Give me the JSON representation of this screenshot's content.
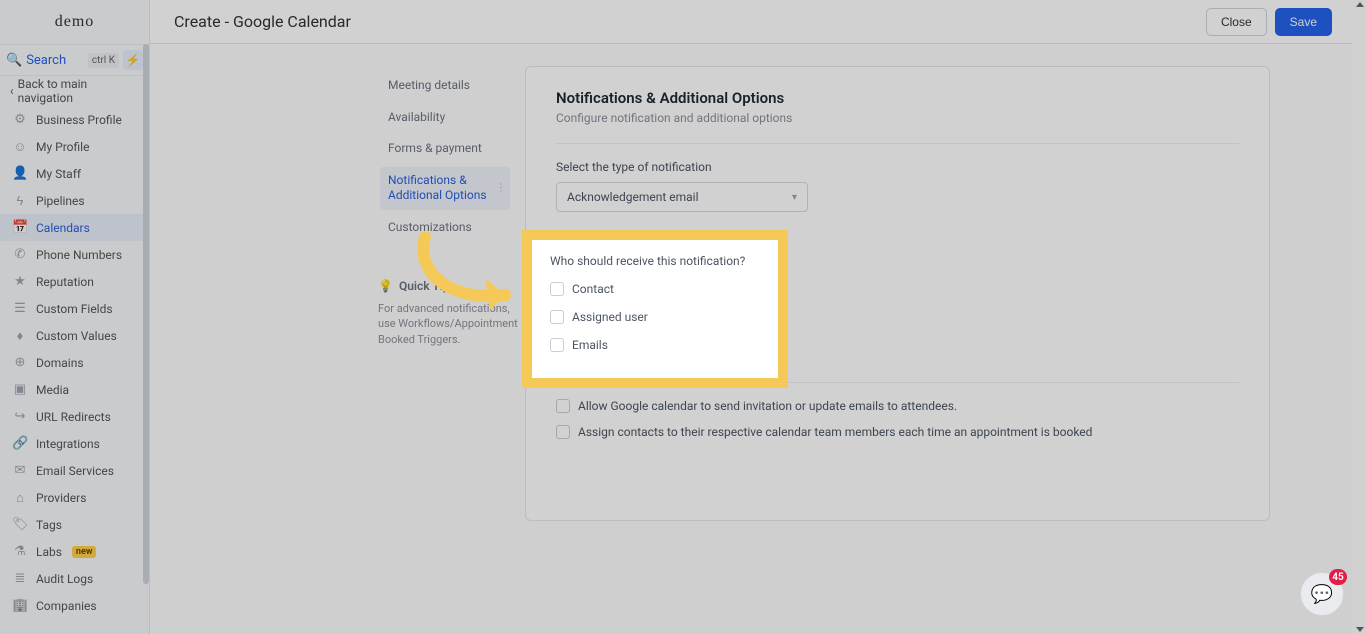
{
  "brand": "demo",
  "search": {
    "label": "Search",
    "shortcut": "ctrl K"
  },
  "back_label": "Back to main navigation",
  "sidebar": {
    "items": [
      {
        "label": "Business Profile",
        "icon": "⚙"
      },
      {
        "label": "My Profile",
        "icon": "☺"
      },
      {
        "label": "My Staff",
        "icon": "👤"
      },
      {
        "label": "Pipelines",
        "icon": "ϟ"
      },
      {
        "label": "Calendars",
        "icon": "📅"
      },
      {
        "label": "Phone Numbers",
        "icon": "✆"
      },
      {
        "label": "Reputation",
        "icon": "★"
      },
      {
        "label": "Custom Fields",
        "icon": "☰"
      },
      {
        "label": "Custom Values",
        "icon": "♦"
      },
      {
        "label": "Domains",
        "icon": "⊕"
      },
      {
        "label": "Media",
        "icon": "▣"
      },
      {
        "label": "URL Redirects",
        "icon": "↪"
      },
      {
        "label": "Integrations",
        "icon": "🔗"
      },
      {
        "label": "Email Services",
        "icon": "✉"
      },
      {
        "label": "Providers",
        "icon": "⌂"
      },
      {
        "label": "Tags",
        "icon": "🏷"
      },
      {
        "label": "Labs",
        "icon": "⚗"
      },
      {
        "label": "Audit Logs",
        "icon": "≣"
      },
      {
        "label": "Companies",
        "icon": "🏢"
      }
    ],
    "active_index": 4,
    "labs_badge": "new"
  },
  "topbar": {
    "title": "Create - Google Calendar",
    "close": "Close",
    "save": "Save"
  },
  "steps": {
    "items": [
      "Meeting details",
      "Availability",
      "Forms & payment",
      "Notifications & Additional Options",
      "Customizations"
    ],
    "active_index": 3
  },
  "quicktip": {
    "title": "Quick Tip",
    "text": "For advanced notifications, use Workflows/Appointment Booked Triggers."
  },
  "card": {
    "title": "Notifications & Additional Options",
    "subtitle": "Configure notification and additional options",
    "select_label": "Select the type of notification",
    "select_value": "Acknowledgement email",
    "who_label": "Who should receive this notification?",
    "options": [
      "Contact",
      "Assigned user",
      "Emails"
    ],
    "extra": [
      "Allow Google calendar to send invitation or update emails to attendees.",
      "Assign contacts to their respective calendar team members each time an appointment is booked"
    ]
  },
  "chat_badge": "45"
}
